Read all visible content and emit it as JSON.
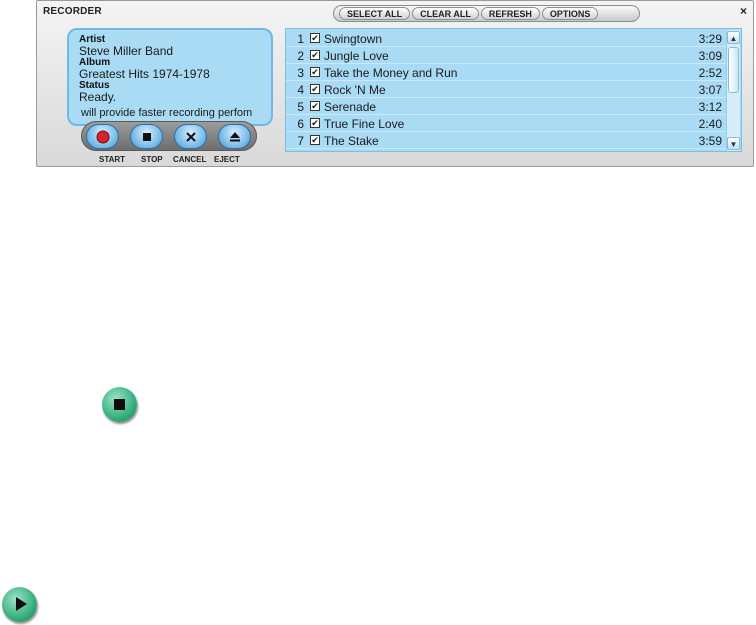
{
  "window": {
    "title": "RECORDER",
    "close_label": "×"
  },
  "toolbar": {
    "select_all": "SELECT ALL",
    "clear_all": "CLEAR ALL",
    "refresh": "REFRESH",
    "options": "OPTIONS"
  },
  "info": {
    "artist_label": "Artist",
    "artist_value": "Steve Miller Band",
    "album_label": "Album",
    "album_value": "Greatest Hits 1974-1978",
    "status_label": "Status",
    "status_value": "Ready.",
    "message": "will provide faster recording perfom"
  },
  "transport": {
    "start": "START",
    "stop": "STOP",
    "cancel": "CANCEL",
    "eject": "EJECT"
  },
  "tracks": [
    {
      "num": "1",
      "checked": "✔",
      "name": "Swingtown",
      "time": "3:29"
    },
    {
      "num": "2",
      "checked": "✔",
      "name": "Jungle Love",
      "time": "3:09"
    },
    {
      "num": "3",
      "checked": "✔",
      "name": "Take the Money and Run",
      "time": "2:52"
    },
    {
      "num": "4",
      "checked": "✔",
      "name": "Rock 'N Me",
      "time": "3:07"
    },
    {
      "num": "5",
      "checked": "✔",
      "name": "Serenade",
      "time": "3:12"
    },
    {
      "num": "6",
      "checked": "✔",
      "name": "True Fine Love",
      "time": "2:40"
    },
    {
      "num": "7",
      "checked": "✔",
      "name": "The Stake",
      "time": "3:59"
    }
  ],
  "scroll": {
    "up": "▲",
    "down": "▼"
  },
  "icons": {
    "stop_icon": "stop-icon",
    "play_icon": "play-icon"
  }
}
